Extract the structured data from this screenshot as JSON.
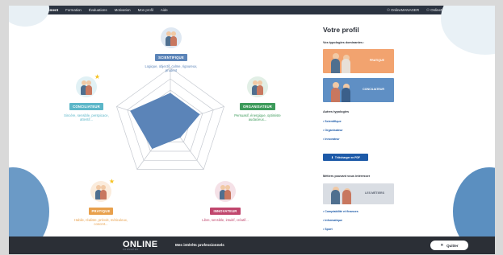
{
  "nav": {
    "left": [
      "Accueil",
      "Positionnement",
      "Formation",
      "Évaluations",
      "Motivation",
      "Mon profil",
      "Aide"
    ],
    "active_index": 1,
    "user_right_1": "OnlineMANAGER",
    "user_right_2": "OnlineNOORA"
  },
  "radar": {
    "axes": [
      "Scientifique",
      "Organisateur",
      "Innovateur",
      "Pratique",
      "Conciliateur"
    ],
    "scores": [
      0.55,
      0.55,
      0.3,
      0.55,
      0.75
    ],
    "rings": 5,
    "fill_color": "#5b84b8",
    "grid_color": "#c6cad1"
  },
  "nodes": {
    "scientifique": {
      "label": "SCIENTIFIQUE",
      "desc": "Logique, objectif, calme, rigoureux, prudent",
      "color": "#5b84b8"
    },
    "organisateur": {
      "label": "ORGANISATEUR",
      "desc": "Persuasif, énergique, optimiste audacieux...",
      "color": "#3c9a5a"
    },
    "innovateur": {
      "label": "INNOVATEUR",
      "desc": "Libre, sensible, intuitif, créatif...",
      "color": "#c0466d"
    },
    "pratique": {
      "label": "PRATIQUE",
      "desc": "Habile, réaliste, prévoit, méticuleux, concret...",
      "color": "#e8a04c"
    },
    "conciliateur": {
      "label": "CONCILIATEUR",
      "desc": "Sincère, sensible, perspicace, attentif...",
      "color": "#5bb6c8"
    }
  },
  "profile": {
    "title": "Votre profil",
    "dominant_heading": "Vos typologies dominantes :",
    "dominant": [
      {
        "label": "PRATIQUE",
        "bg": "#f2a36f"
      },
      {
        "label": "CONCILIATEUR",
        "bg": "#5f8fc4"
      }
    ],
    "others_heading": "Autres typologies",
    "others": [
      "• Scientifique",
      "• Organisateur",
      "• Innovateur"
    ],
    "download_label": "Télécharger en PDF",
    "jobs_heading": "Métiers pouvant vous intéresser",
    "jobs_card_label": "LES MÉTIERS",
    "jobs": [
      "• Comptabilité et finances",
      "• Informatique",
      "• Sport"
    ]
  },
  "bottom": {
    "logo": "ONLINE",
    "logo_sub": "FORMAPRO",
    "title": "Mes intérêts professionnels",
    "quit": "Quitter"
  }
}
